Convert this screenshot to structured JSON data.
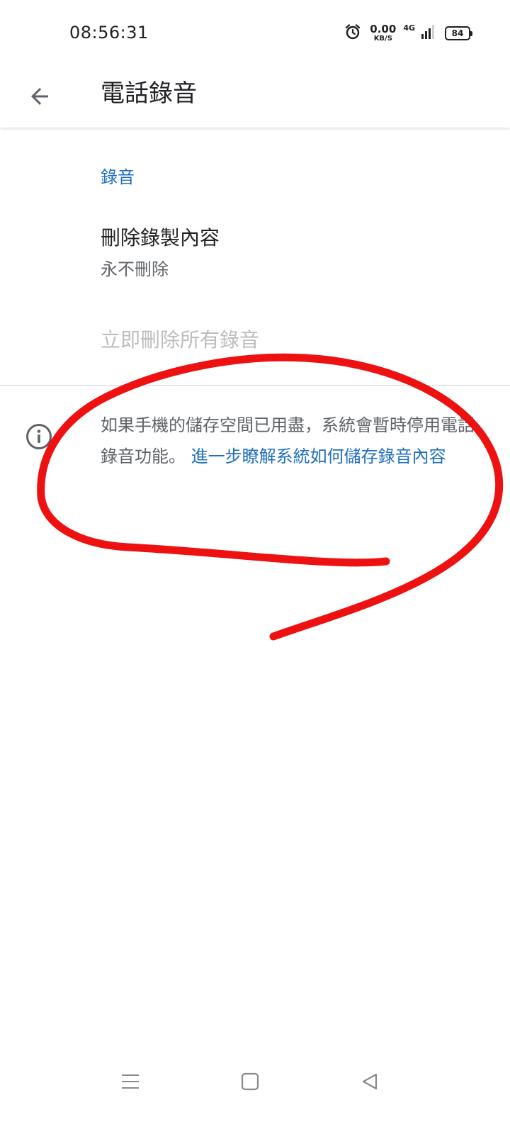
{
  "status_bar": {
    "time": "08:56:31",
    "net_speed_value": "0.00",
    "net_speed_unit": "KB/S",
    "network_type": "4G",
    "battery_level": "84"
  },
  "app_bar": {
    "title": "電話錄音",
    "back_icon": "arrow-left-icon"
  },
  "section": {
    "header": "錄音"
  },
  "preferences": {
    "delete_recordings": {
      "title": "刪除錄製內容",
      "summary": "永不刪除"
    },
    "delete_all": {
      "title": "立即刪除所有錄音",
      "enabled": false
    }
  },
  "info": {
    "icon": "info-icon",
    "text": "如果手機的儲存空間已用盡，系統會暫時停用電話錄音功能。",
    "link": "進一步瞭解系統如何儲存錄音內容"
  },
  "nav_bar": {
    "icons": [
      "menu-icon",
      "home-icon",
      "back-icon"
    ]
  },
  "colors": {
    "accent": "#1f6fbf",
    "annotation": "#ee1111",
    "disabled_text": "#bdbdbd",
    "secondary_text": "#5f6368"
  }
}
